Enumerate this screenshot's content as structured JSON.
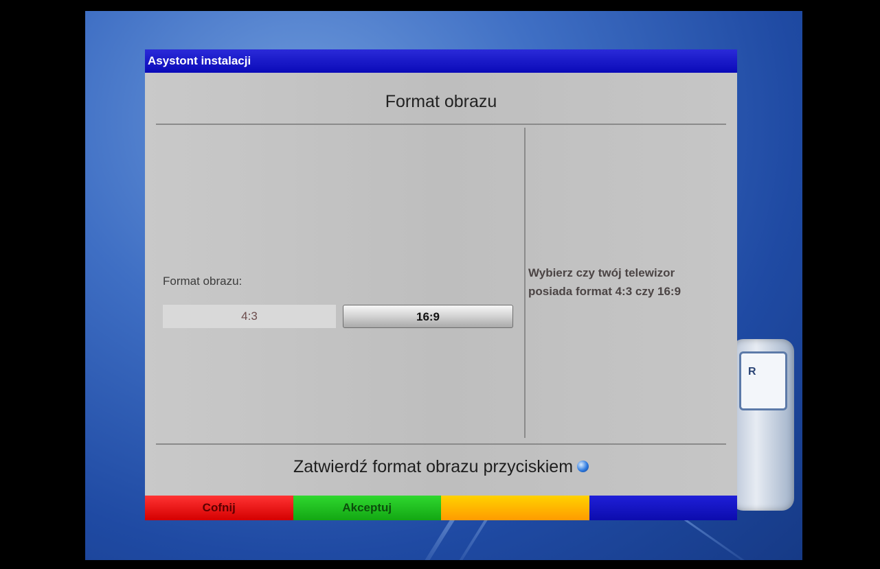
{
  "window": {
    "title": "Asystont instalacji",
    "heading": "Format obrazu"
  },
  "form": {
    "label": "Format obrazu:",
    "options": [
      {
        "label": "4:3",
        "selected": false
      },
      {
        "label": "16:9",
        "selected": true
      }
    ]
  },
  "help": {
    "line1": "Wybierz czy twój telewizor",
    "line2": "posiada format 4:3 czy 16:9"
  },
  "footer": {
    "instruction": "Zatwierdź format obrazu przyciskiem",
    "ok_icon": "ok-button-icon"
  },
  "color_buttons": {
    "red": {
      "label": "Cofnij",
      "color": "#ff0000"
    },
    "green": {
      "label": "Akceptuj",
      "color": "#1fc41f"
    },
    "yellow": {
      "label": "",
      "color": "#ffb800"
    },
    "blue": {
      "label": "",
      "color": "#1010c8"
    }
  },
  "background": {
    "scart_label": "R"
  }
}
